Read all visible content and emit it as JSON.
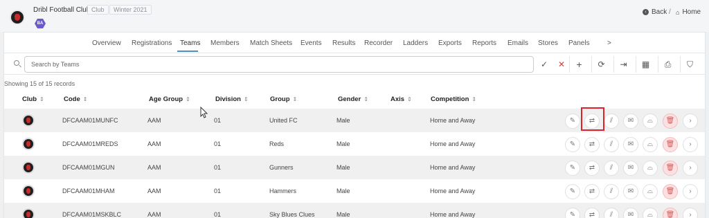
{
  "header": {
    "club_name": "Dribl Football Club",
    "club_tag": "Club",
    "season_tag": "Winter 2021",
    "badge": "BA",
    "back_label": "Back",
    "separator": "/",
    "home_label": "Home"
  },
  "tabs": [
    "Overview",
    "Registrations",
    "Teams",
    "Members",
    "Match Sheets",
    "Events",
    "Results",
    "Recorder",
    "Ladders",
    "Exports",
    "Reports",
    "Emails",
    "Stores",
    "Panels",
    ">"
  ],
  "active_tab": "Teams",
  "search": {
    "placeholder": "Search by Teams",
    "value": ""
  },
  "toolbar": {
    "check": "✓",
    "clear": "✕",
    "add": "+",
    "refresh": "⟳",
    "export": "⇥",
    "grid": "▦",
    "pdf": "⎙",
    "filter": "⛉"
  },
  "records_text": "Showing 15 of 15 records",
  "columns": {
    "club": "Club",
    "code": "Code",
    "age_group": "Age Group",
    "division": "Division",
    "group": "Group",
    "gender": "Gender",
    "axis": "Axis",
    "competition": "Competition",
    "sort": "⇕"
  },
  "rows": [
    {
      "code": "DFCAAM01MUNFC",
      "age_group": "AAM",
      "division": "01",
      "group": "United FC",
      "gender": "Male",
      "competition": "Home and Away"
    },
    {
      "code": "DFCAAM01MREDS",
      "age_group": "AAM",
      "division": "01",
      "group": "Reds",
      "gender": "Male",
      "competition": "Home and Away"
    },
    {
      "code": "DFCAAM01MGUN",
      "age_group": "AAM",
      "division": "01",
      "group": "Gunners",
      "gender": "Male",
      "competition": "Home and Away"
    },
    {
      "code": "DFCAAM01MHAM",
      "age_group": "AAM",
      "division": "01",
      "group": "Hammers",
      "gender": "Male",
      "competition": "Home and Away"
    },
    {
      "code": "DFCAAM01MSKBLC",
      "age_group": "AAM",
      "division": "01",
      "group": "Sky Blues Clues",
      "gender": "Male",
      "competition": "Home and Away"
    }
  ],
  "row_actions": [
    {
      "name": "edit-icon",
      "glyph": "✎"
    },
    {
      "name": "transfer-icon",
      "glyph": "⇄"
    },
    {
      "name": "unlink-icon",
      "glyph": "⫽"
    },
    {
      "name": "mail-icon",
      "glyph": "✉"
    },
    {
      "name": "boot-icon",
      "glyph": "⌓"
    },
    {
      "name": "trash-icon",
      "glyph": "🗑"
    },
    {
      "name": "chevron-right-icon",
      "glyph": "›"
    }
  ],
  "colors": {
    "accent": "#4a90c2",
    "danger": "#e03b3b",
    "highlight": "#e0202a",
    "badge": "#6a5acd"
  }
}
